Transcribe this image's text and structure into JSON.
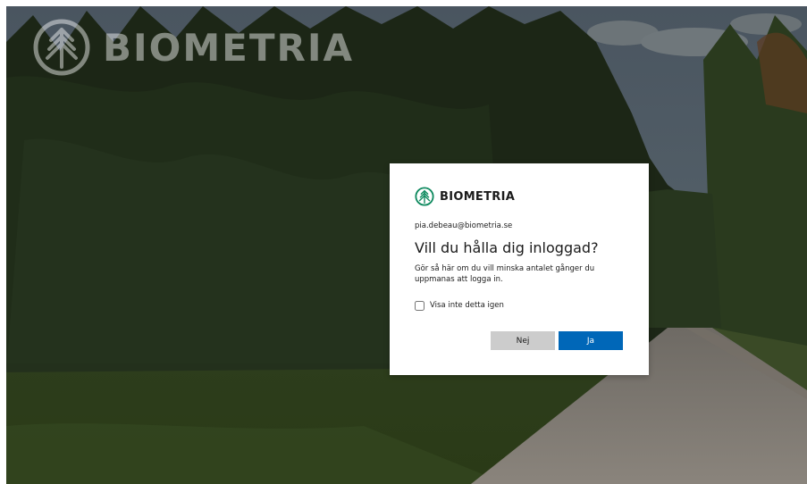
{
  "background": {
    "logo_text": "BIOMETRIA",
    "logo_icon": "biometria-tree-icon"
  },
  "dialog": {
    "brand_name": "BIOMETRIA",
    "brand_icon": "biometria-tree-icon",
    "identity": "pia.debeau@biometria.se",
    "title": "Vill du hålla dig inloggad?",
    "description": "Gör så här om du vill minska antalet gånger du uppmanas att logga in.",
    "checkbox_label": "Visa inte detta igen",
    "checkbox_checked": false,
    "no_button": "Nej",
    "yes_button": "Ja"
  },
  "colors": {
    "primary": "#0067b8",
    "secondary_button": "#cccccc",
    "brand_green": "#0f8a5f"
  }
}
